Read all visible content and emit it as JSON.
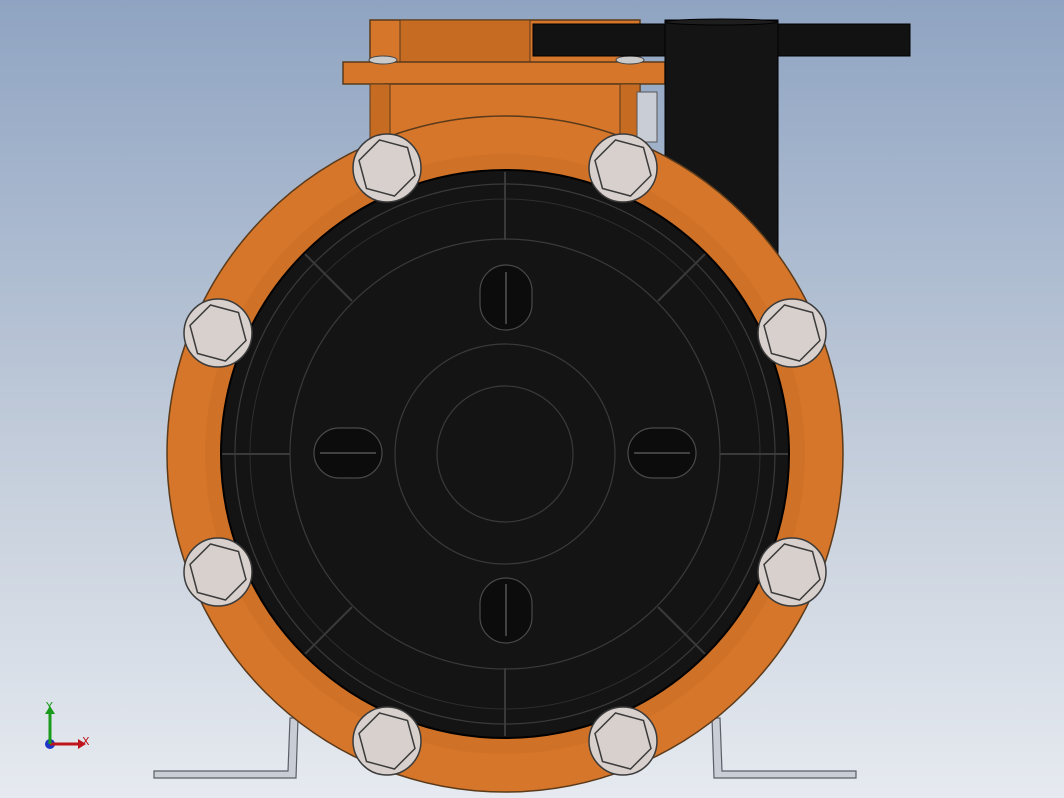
{
  "window": {
    "title": ""
  },
  "colors": {
    "housing": "#d5762a",
    "housing_shade": "#c66b22",
    "housing_dark": "#a5561b",
    "cover": "#141414",
    "cover_line": "#3a3a3a",
    "bolt": "#d8d0cc",
    "bolt_edge": "#3b3b3b",
    "bracket": "#c9cdd6",
    "axis_x": "#c0141c",
    "axis_y": "#1a9a1a",
    "axis_z": "#1f35c8"
  },
  "triad": {
    "x_label": "X",
    "y_label": "Y"
  },
  "bolts": [
    {
      "id": "bolt-top-left"
    },
    {
      "id": "bolt-top-right"
    },
    {
      "id": "bolt-upper-left"
    },
    {
      "id": "bolt-upper-right"
    },
    {
      "id": "bolt-lower-left"
    },
    {
      "id": "bolt-lower-right"
    },
    {
      "id": "bolt-bottom-left"
    },
    {
      "id": "bolt-bottom-right"
    }
  ]
}
